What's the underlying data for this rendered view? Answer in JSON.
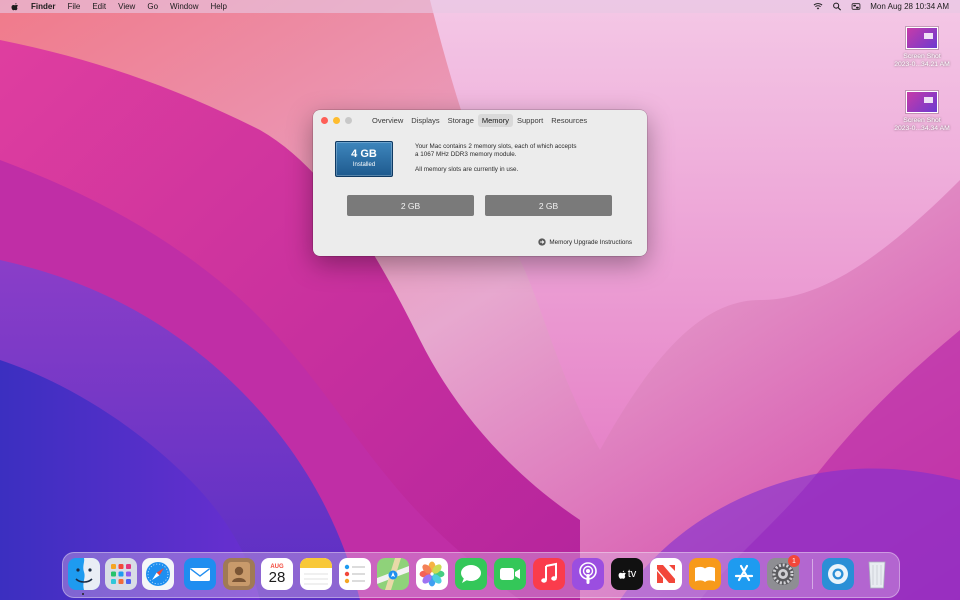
{
  "menubar": {
    "app_name": "Finder",
    "items": [
      "File",
      "Edit",
      "View",
      "Go",
      "Window",
      "Help"
    ],
    "datetime": "Mon Aug 28  10:34 AM"
  },
  "desktop": {
    "icons": [
      {
        "line1": "Screen Shot",
        "line2": "2023-0...34.21 AM"
      },
      {
        "line1": "Screen Shot",
        "line2": "2023-0...34.34 AM"
      }
    ]
  },
  "about_window": {
    "tabs": [
      "Overview",
      "Displays",
      "Storage",
      "Memory",
      "Support",
      "Resources"
    ],
    "active_tab": "Memory",
    "memory_total": "4 GB",
    "memory_status": "Installed",
    "description_line1": "Your Mac contains 2 memory slots, each of which accepts",
    "description_line2": "a 1067 MHz DDR3 memory module.",
    "description_line3": "All memory slots are currently in use.",
    "slots": [
      "2 GB",
      "2 GB"
    ],
    "upgrade_link": "Memory Upgrade Instructions"
  },
  "dock": {
    "calendar_month": "AUG",
    "calendar_day": "28",
    "appletv_label": "tv",
    "settings_badge": "1",
    "apps": [
      "finder",
      "launchpad",
      "safari",
      "mail",
      "contacts",
      "calendar",
      "notes",
      "reminders",
      "maps",
      "photos",
      "messages",
      "facetime",
      "music",
      "podcasts",
      "tv",
      "news",
      "books",
      "app-store",
      "system-preferences",
      "system-information",
      "trash"
    ]
  },
  "colors": {
    "close": "#fe5f57",
    "minimize": "#febc2e",
    "memory_badge": "#2a6ea6",
    "slot": "#7a7a7a"
  }
}
